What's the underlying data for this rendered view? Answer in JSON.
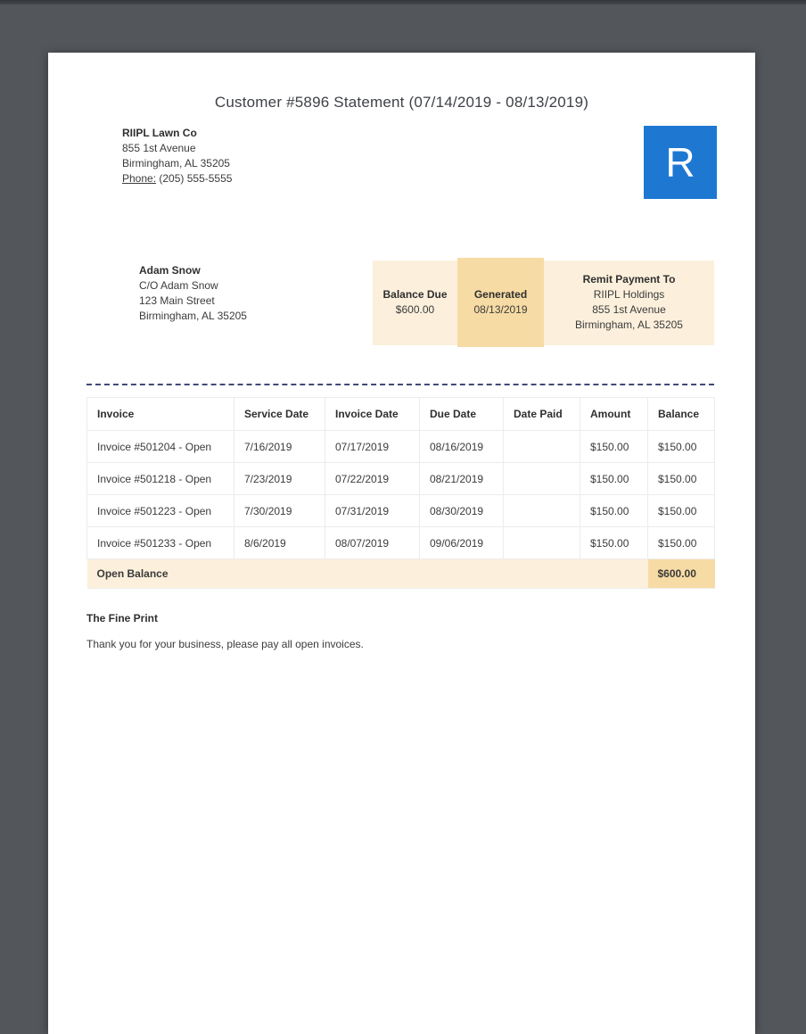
{
  "doc": {
    "title": "Customer #5896 Statement (07/14/2019 - 08/13/2019)"
  },
  "company": {
    "name": "RIIPL Lawn Co",
    "address_line1": "855 1st Avenue",
    "address_line2": "Birmingham, AL 35205",
    "phone_label": "Phone:",
    "phone_number": "(205) 555-5555",
    "logo_letter": "R"
  },
  "customer": {
    "name": "Adam Snow",
    "care_of": "C/O Adam Snow",
    "street": "123 Main Street",
    "city": "Birmingham, AL 35205"
  },
  "summary": {
    "balance_due_label": "Balance Due",
    "balance_due_value": "$600.00",
    "generated_label": "Generated",
    "generated_value": "08/13/2019",
    "remit_label": "Remit Payment To",
    "remit_name": "RIIPL Holdings",
    "remit_street": "855 1st Avenue",
    "remit_city": "Birmingham, AL 35205"
  },
  "invoice_table": {
    "headers": [
      "Invoice",
      "Service Date",
      "Invoice Date",
      "Due Date",
      "Date Paid",
      "Amount",
      "Balance"
    ],
    "rows": [
      [
        "Invoice #501204 - Open",
        "7/16/2019",
        "07/17/2019",
        "08/16/2019",
        "",
        "$150.00",
        "$150.00"
      ],
      [
        "Invoice #501218 - Open",
        "7/23/2019",
        "07/22/2019",
        "08/21/2019",
        "",
        "$150.00",
        "$150.00"
      ],
      [
        "Invoice #501223 - Open",
        "7/30/2019",
        "07/31/2019",
        "08/30/2019",
        "",
        "$150.00",
        "$150.00"
      ],
      [
        "Invoice #501233 - Open",
        "8/6/2019",
        "08/07/2019",
        "09/06/2019",
        "",
        "$150.00",
        "$150.00"
      ]
    ],
    "footer_label": "Open Balance",
    "footer_value": "$600.00"
  },
  "fine_print": {
    "heading": "The Fine Print",
    "text": "Thank you for your business, please pay all open invoices."
  },
  "colors": {
    "accent_blue": "#1e78d2",
    "peach_light": "#fcf0dc",
    "peach_dark": "#f7dba4",
    "divider_navy": "#3f4a76",
    "viewer_background": "#53575b"
  }
}
